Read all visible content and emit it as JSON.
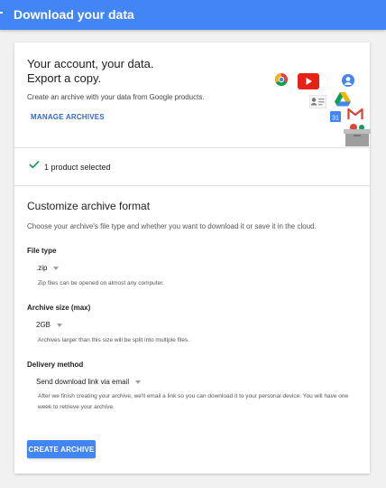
{
  "appbar": {
    "title": "Download your data"
  },
  "hero": {
    "headline_line1": "Your account, your data.",
    "headline_line2": "Export a copy.",
    "subtext": "Create an archive with your data from Google products.",
    "manage_archives_label": "MANAGE ARCHIVES",
    "icons": [
      "chrome-icon",
      "youtube-icon",
      "google-plus-icon",
      "contacts-icon",
      "drive-icon",
      "calendar-icon",
      "gmail-icon",
      "archive-box-icon"
    ]
  },
  "selection": {
    "text": "1 product selected"
  },
  "customize": {
    "title": "Customize archive format",
    "description": "Choose your archive's file type and whether you want to download it or save it in the cloud.",
    "file_type": {
      "label": "File type",
      "value": ".zip",
      "hint": "Zip files can be opened on almost any computer."
    },
    "archive_size": {
      "label": "Archive size (max)",
      "value": "2GB",
      "hint": "Archives larger than this size will be split into multiple files."
    },
    "delivery": {
      "label": "Delivery method",
      "value": "Send download link via email",
      "hint": "After we finish creating your archive, we'll email a link so you can download it to your personal device. You will have one week to retrieve your archive."
    },
    "create_label": "CREATE ARCHIVE"
  },
  "colors": {
    "appbar": "#4285f4",
    "link": "#3367d6",
    "check": "#0f9d58",
    "button": "#4285f4"
  }
}
